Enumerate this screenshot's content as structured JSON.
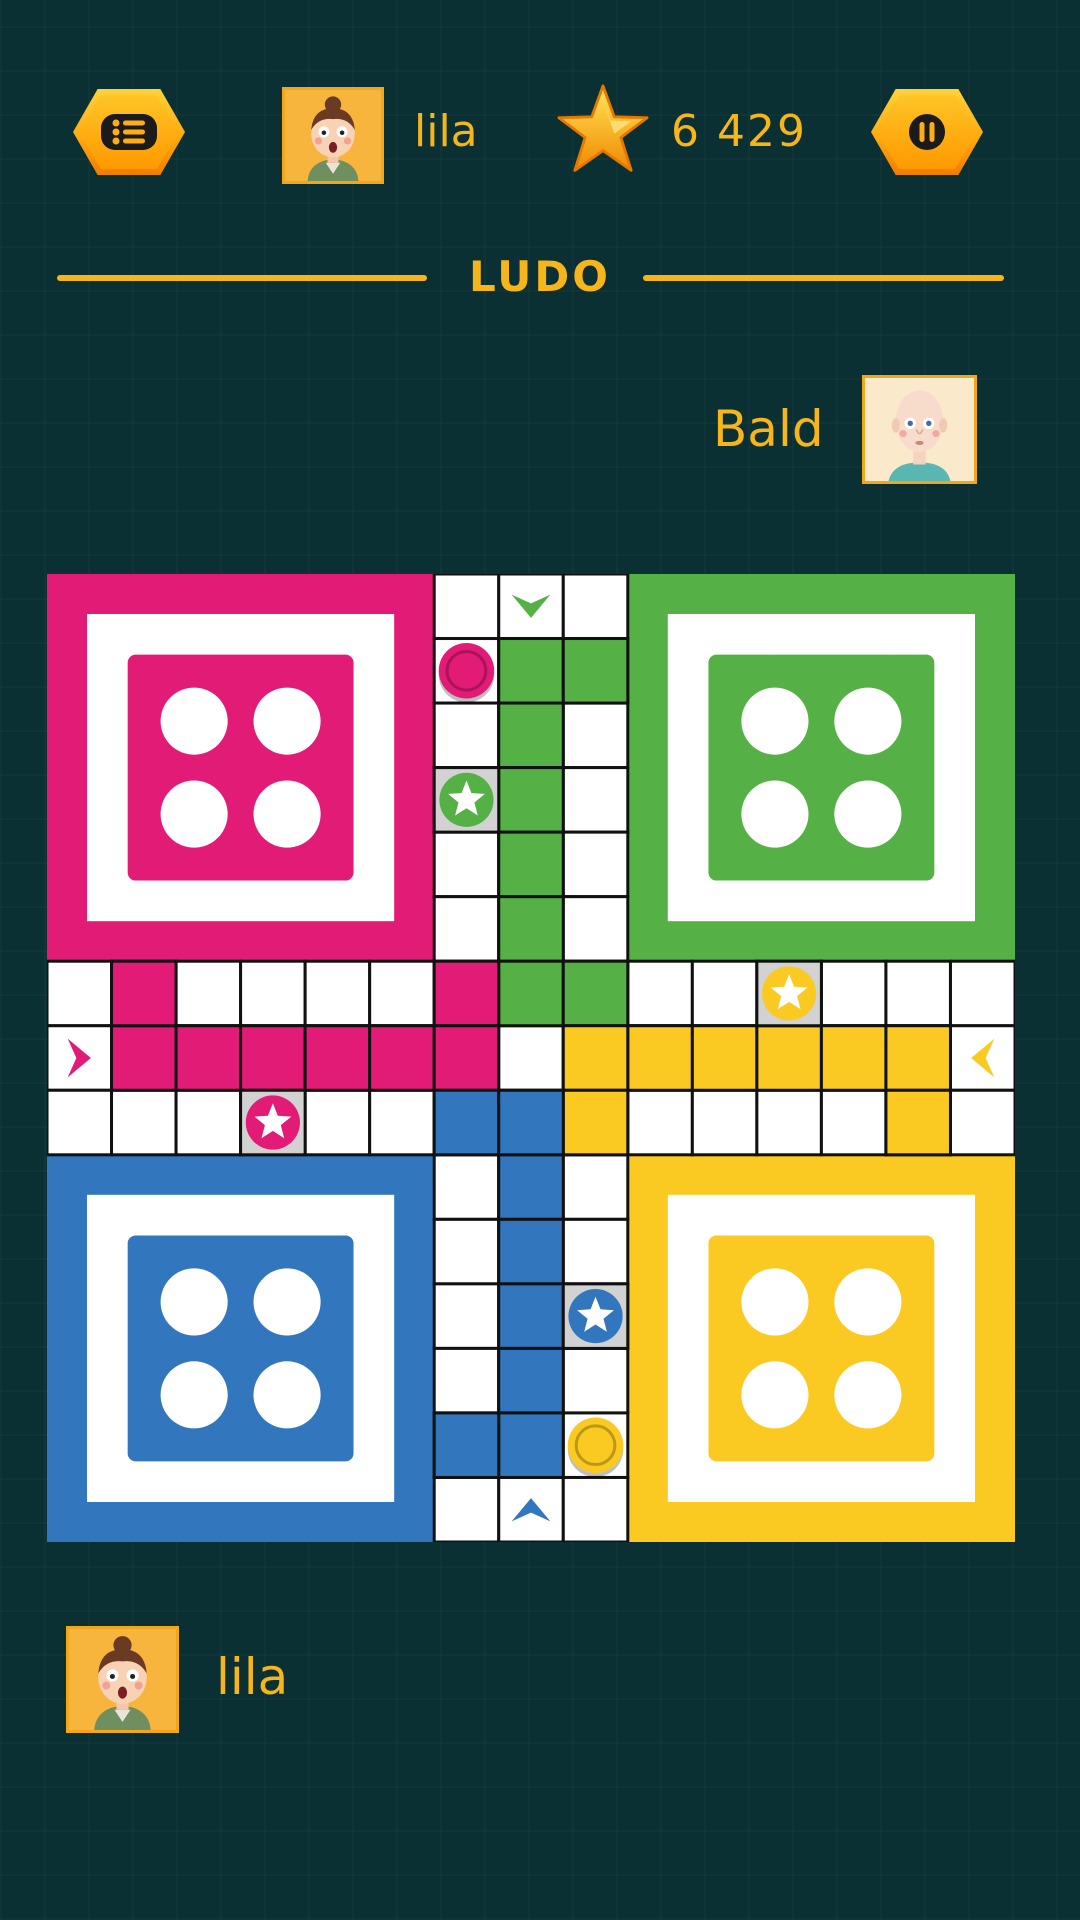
{
  "header": {
    "menu_icon": "list-icon",
    "player_name": "lila",
    "star_icon": "star-icon",
    "score": "6 429",
    "pause_icon": "pause-icon"
  },
  "title": "LUDO",
  "opponent": {
    "name": "Bald"
  },
  "player": {
    "name": "lila"
  },
  "colors": {
    "background": "#0b3034",
    "accent": "#f6b51b",
    "red": "#e21b77",
    "green": "#55b146",
    "yellow": "#fbca22",
    "blue": "#3277be"
  },
  "board": {
    "home_bases": [
      "red",
      "green",
      "blue",
      "yellow"
    ],
    "pieces": [
      {
        "color": "red",
        "track": "top-column",
        "row": 1,
        "col": 0
      },
      {
        "color": "yellow",
        "track": "bottom-column",
        "row": 4,
        "col": 2
      }
    ],
    "safe_stars": [
      {
        "color": "green",
        "track": "top-column",
        "row": 3,
        "col": 0
      },
      {
        "color": "yellow",
        "track": "right-row",
        "row": 0,
        "col": 2
      },
      {
        "color": "red",
        "track": "left-row",
        "row": 2,
        "col": 3
      },
      {
        "color": "blue",
        "track": "bottom-column",
        "row": 2,
        "col": 2
      }
    ],
    "start_arrows": [
      {
        "color": "green",
        "direction": "down"
      },
      {
        "color": "yellow",
        "direction": "left"
      },
      {
        "color": "red",
        "direction": "right"
      },
      {
        "color": "blue",
        "direction": "up"
      }
    ]
  }
}
